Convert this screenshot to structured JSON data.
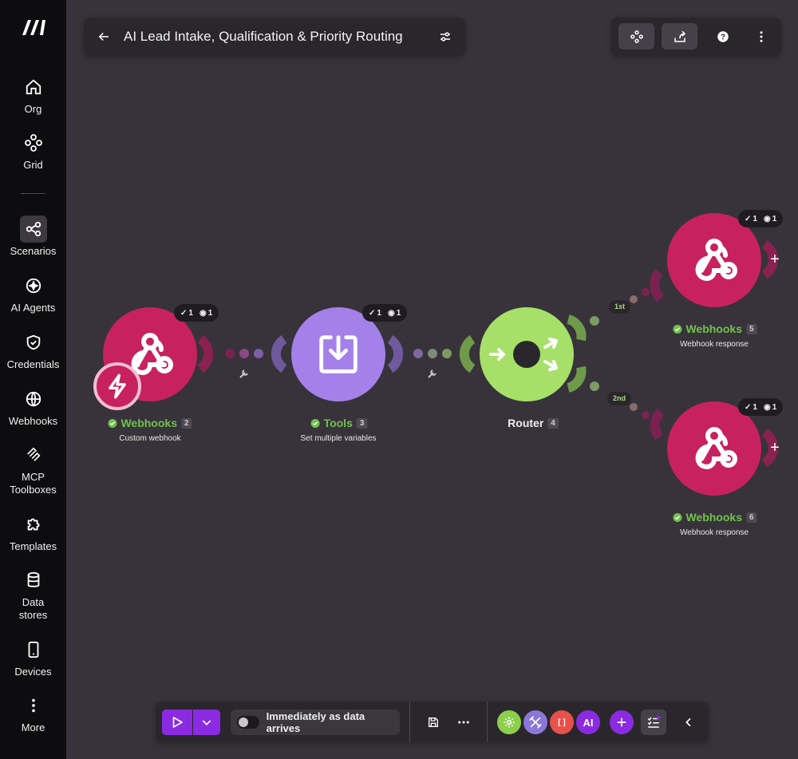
{
  "sidebar": {
    "items": [
      {
        "label": "Org",
        "icon": "home-icon"
      },
      {
        "label": "Grid",
        "icon": "grid-icon"
      },
      {
        "label": "Scenarios",
        "icon": "scenarios-icon"
      },
      {
        "label": "AI Agents",
        "icon": "ai-agents-icon"
      },
      {
        "label": "Credentials",
        "icon": "shield-icon"
      },
      {
        "label": "Webhooks",
        "icon": "globe-icon"
      },
      {
        "label": "MCP Toolboxes",
        "icon": "mcp-icon"
      },
      {
        "label": "Templates",
        "icon": "puzzle-icon"
      },
      {
        "label": "Data stores",
        "icon": "database-icon"
      },
      {
        "label": "Devices",
        "icon": "phone-icon"
      },
      {
        "label": "More",
        "icon": "more-vertical-icon"
      }
    ]
  },
  "header": {
    "title": "AI Lead Intake, Qualification & Priority Routing"
  },
  "nodes": [
    {
      "app": "Webhooks",
      "id": "2",
      "sub": "Custom webhook",
      "ops": "1",
      "bundles": "1"
    },
    {
      "app": "Tools",
      "id": "3",
      "sub": "Set multiple variables",
      "ops": "1",
      "bundles": "1"
    },
    {
      "app": "Router",
      "id": "4"
    },
    {
      "app": "Webhooks",
      "id": "5",
      "sub": "Webhook response",
      "ops": "1",
      "bundles": "1"
    },
    {
      "app": "Webhooks",
      "id": "6",
      "sub": "Webhook response",
      "ops": "1",
      "bundles": "1"
    }
  ],
  "routes": {
    "first": "1st",
    "second": "2nd"
  },
  "bottom": {
    "schedule_label": "Immediately as data arrives",
    "ai_label": "AI",
    "flow_control_label": "[ ]"
  },
  "colors": {
    "webhook": "#c8215f",
    "tools": "#a381e8",
    "router": "#a6e068",
    "accent": "#8a2be2",
    "success": "#6fc24c"
  }
}
